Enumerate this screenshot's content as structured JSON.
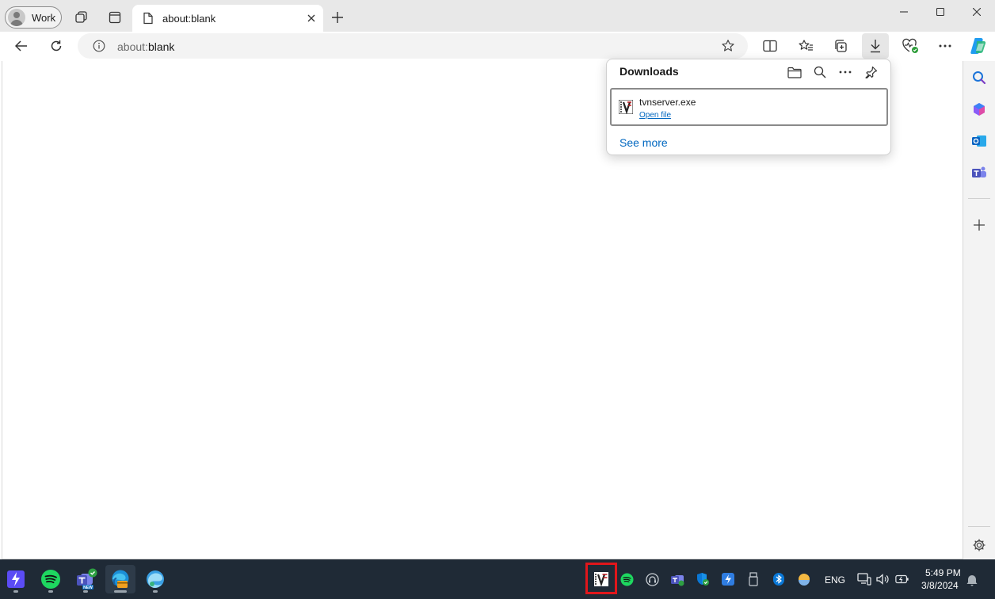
{
  "browser": {
    "profile_label": "Work",
    "tab_title": "about:blank",
    "address_scheme": "about:",
    "address_rest": "blank"
  },
  "downloads": {
    "title": "Downloads",
    "items": [
      {
        "filename": "tvnserver.exe",
        "action_label": "Open file"
      }
    ],
    "see_more_label": "See more"
  },
  "taskbar": {
    "language": "ENG",
    "time": "5:49 PM",
    "date": "3/8/2024",
    "apps": [
      "power-automate-icon",
      "spotify-icon",
      "teams-new-icon",
      "edge-dev-icon",
      "edge-icon"
    ],
    "tray": [
      "tightvnc-icon",
      "spotify-tray-icon",
      "headset-icon",
      "teams-tray-icon",
      "defender-icon",
      "power-automate-tray-icon",
      "usb-icon",
      "bluetooth-icon",
      "weather-icon",
      "network-icon",
      "volume-icon",
      "battery-icon",
      "notification-bell-icon"
    ]
  },
  "colors": {
    "accent": "#0067c0",
    "taskbar": "#1f2a36",
    "highlight": "#e0161b"
  }
}
